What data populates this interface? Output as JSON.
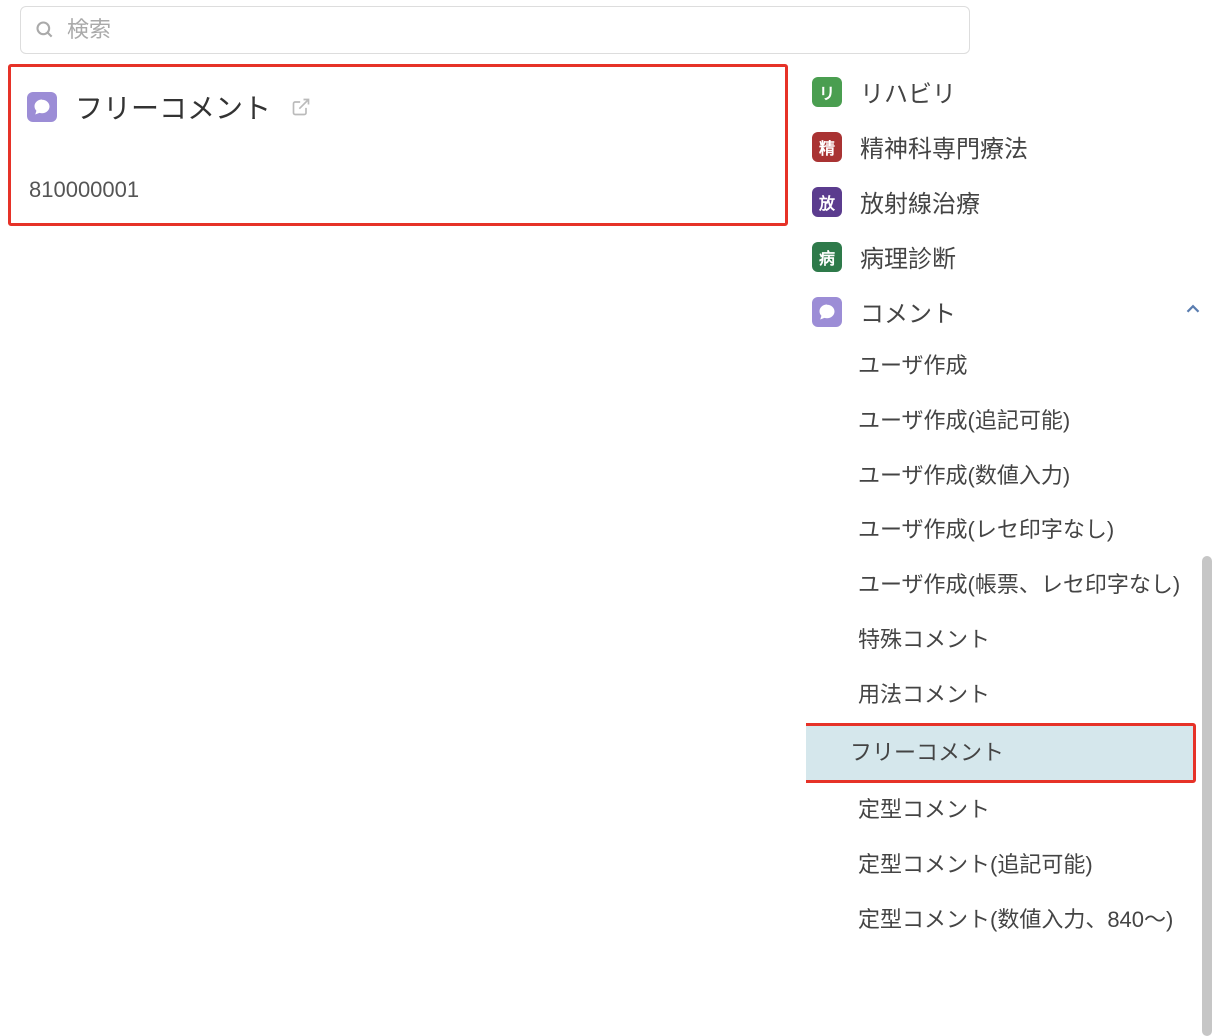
{
  "search": {
    "placeholder": "検索"
  },
  "main": {
    "title": "フリーコメント",
    "code": "810000001"
  },
  "sidebar": {
    "categories": [
      {
        "badge": "リ",
        "label": "リハビリ",
        "badge_class": "badge-rehab"
      },
      {
        "badge": "精",
        "label": "精神科専門療法",
        "badge_class": "badge-psych"
      },
      {
        "badge": "放",
        "label": "放射線治療",
        "badge_class": "badge-radio"
      },
      {
        "badge": "病",
        "label": "病理診断",
        "badge_class": "badge-path"
      }
    ],
    "comment_category": {
      "label": "コメント",
      "items": [
        "ユーザ作成",
        "ユーザ作成(追記可能)",
        "ユーザ作成(数値入力)",
        "ユーザ作成(レセ印字なし)",
        "ユーザ作成(帳票、レセ印字なし)",
        "特殊コメント",
        "用法コメント",
        "フリーコメント",
        "定型コメント",
        "定型コメント(追記可能)",
        "定型コメント(数値入力、840〜)"
      ],
      "selected_index": 7
    }
  }
}
